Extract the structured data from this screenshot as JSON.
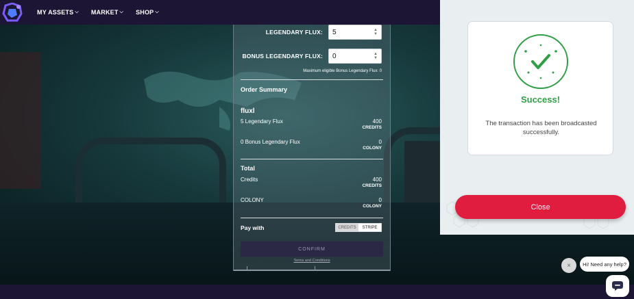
{
  "nav": {
    "items": [
      {
        "label": "MY ASSETS",
        "icon": "chevron-down-icon"
      },
      {
        "label": "MARKET",
        "icon": "chevron-down-icon"
      },
      {
        "label": "SHOP",
        "icon": "chevron-down-icon"
      }
    ]
  },
  "form": {
    "legendary_flux_label": "LEGENDARY FLUX:",
    "legendary_flux_value": "5",
    "bonus_flux_label": "BONUS LEGENDARY FLUX:",
    "bonus_flux_value": "0",
    "max_hint": "Maximum eligible Bonus Legendary Flux: 0"
  },
  "order_summary": {
    "heading": "Order Summary",
    "product": "fluxl",
    "lines": [
      {
        "label": "5 Legendary Flux",
        "amount": "400",
        "unit": "CREDITS"
      },
      {
        "label": "0 Bonus Legendary Flux",
        "amount": "0",
        "unit": "COLONY"
      }
    ],
    "total_heading": "Total",
    "totals": [
      {
        "label": "Credits",
        "amount": "400",
        "unit": "CREDITS"
      },
      {
        "label": "COLONY",
        "amount": "0",
        "unit": "COLONY"
      }
    ],
    "pay_with_label": "Pay with",
    "pay_options": [
      "CREDITS",
      "STRIPE"
    ],
    "confirm_label": "CONFIRM",
    "terms_text": "Terms and Conditions"
  },
  "modal": {
    "title": "Success!",
    "message": "The transaction has been broadcasted successfully.",
    "close_label": "Close",
    "colors": {
      "success": "#2f9e44",
      "close": "#e11d3f"
    }
  },
  "chat": {
    "greeting": "Hi! Need any help?",
    "dismiss": "×"
  }
}
